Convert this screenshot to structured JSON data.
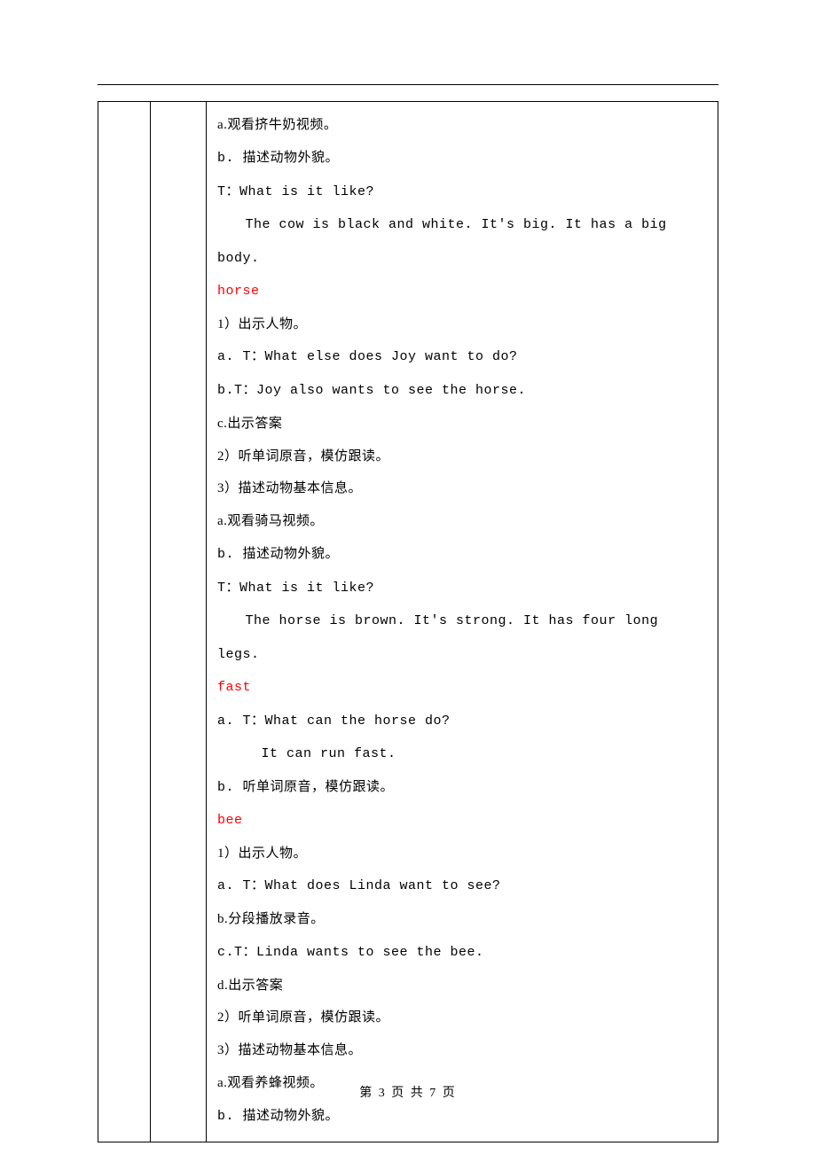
{
  "content": {
    "l01": "a.观看挤牛奶视频。",
    "l02": "b. 描述动物外貌。",
    "l03": "T：What is it like?",
    "l04": "The cow is black and white. It's big. It has a big body.",
    "kw_horse": "horse",
    "l05": "1）出示人物。",
    "l06": "a. T：What else does Joy want to do?",
    "l07": "b.T：Joy also wants to see the horse.",
    "l08": "c.出示答案",
    "l09": "2）听单词原音，模仿跟读。",
    "l10": "3）描述动物基本信息。",
    "l11": "a.观看骑马视频。",
    "l12": "b. 描述动物外貌。",
    "l13": "T：What is it like?",
    "l14": "The horse is brown. It's strong. It has four long legs.",
    "kw_fast": "fast",
    "l15": "a. T：What can the horse do?",
    "l16": "It can run fast.",
    "l17": "b. 听单词原音，模仿跟读。",
    "kw_bee": "bee",
    "l18": "1）出示人物。",
    "l19": "a. T：What does Linda want to see?",
    "l20": "b.分段播放录音。",
    "l21": "c.T：Linda wants to see the bee.",
    "l22": "d.出示答案",
    "l23": "2）听单词原音，模仿跟读。",
    "l24": "3）描述动物基本信息。",
    "l25": "a.观看养蜂视频。",
    "l26": "b. 描述动物外貌。"
  },
  "footer": {
    "text": "第 3 页 共 7 页"
  }
}
